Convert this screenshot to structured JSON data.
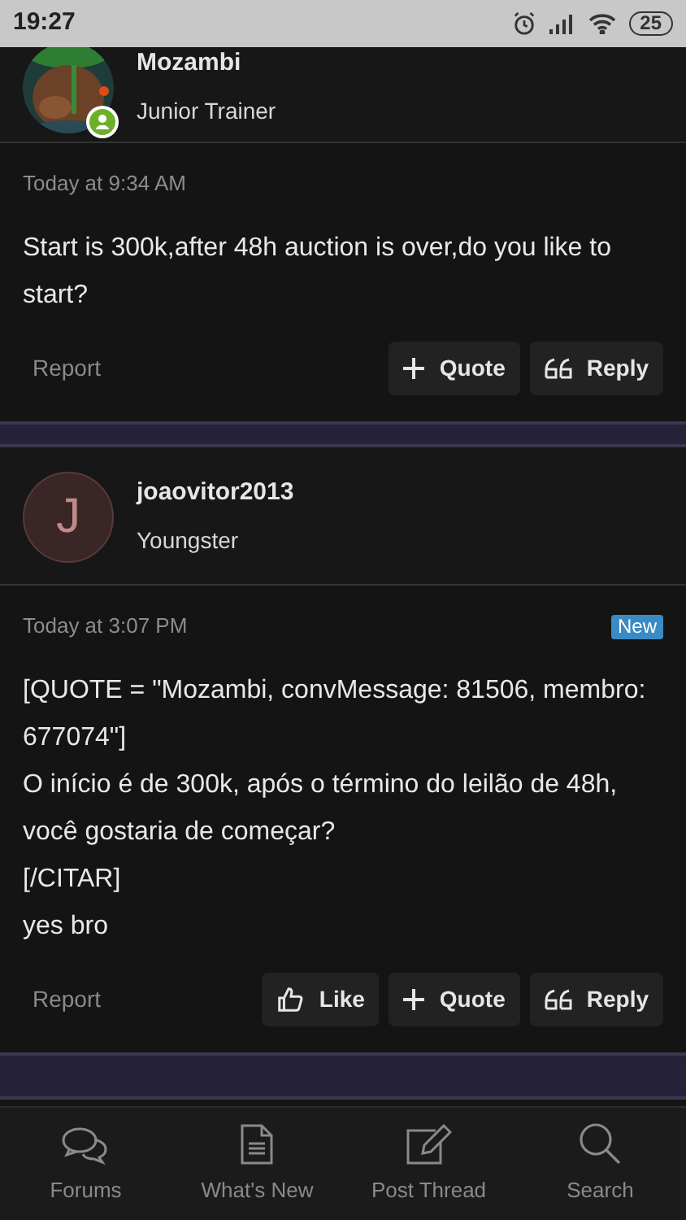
{
  "status_bar": {
    "time": "19:27",
    "battery": "25"
  },
  "posts": [
    {
      "author": "Mozambi",
      "role": "Junior Trainer",
      "avatar": {
        "kind": "picture"
      },
      "online": true,
      "cut_top": true,
      "time": "Today at 9:34 AM",
      "body": [
        "Start is 300k,after 48h auction is over,do you like to start?"
      ],
      "report": "Report",
      "actions": [
        {
          "kind": "quote",
          "label": "Quote"
        },
        {
          "kind": "reply",
          "label": "Reply"
        }
      ]
    },
    {
      "author": "joaovitor2013",
      "role": "Youngster",
      "avatar": {
        "kind": "letter",
        "letter": "J"
      },
      "online": false,
      "cut_top": false,
      "time": "Today at 3:07 PM",
      "badge": "New",
      "body": [
        "[QUOTE = \"Mozambi, convMessage: 81506, membro: 677074\"]",
        "O início é de 300k, após o término do leilão de 48h, você gostaria de começar?",
        "[/CITAR]",
        "yes bro"
      ],
      "report": "Report",
      "actions": [
        {
          "kind": "like",
          "label": "Like"
        },
        {
          "kind": "quote",
          "label": "Quote"
        },
        {
          "kind": "reply",
          "label": "Reply"
        }
      ]
    }
  ],
  "bottom_nav": [
    {
      "kind": "forums",
      "label": "Forums"
    },
    {
      "kind": "new",
      "label": "What's New"
    },
    {
      "kind": "post",
      "label": "Post Thread"
    },
    {
      "kind": "search",
      "label": "Search"
    }
  ]
}
